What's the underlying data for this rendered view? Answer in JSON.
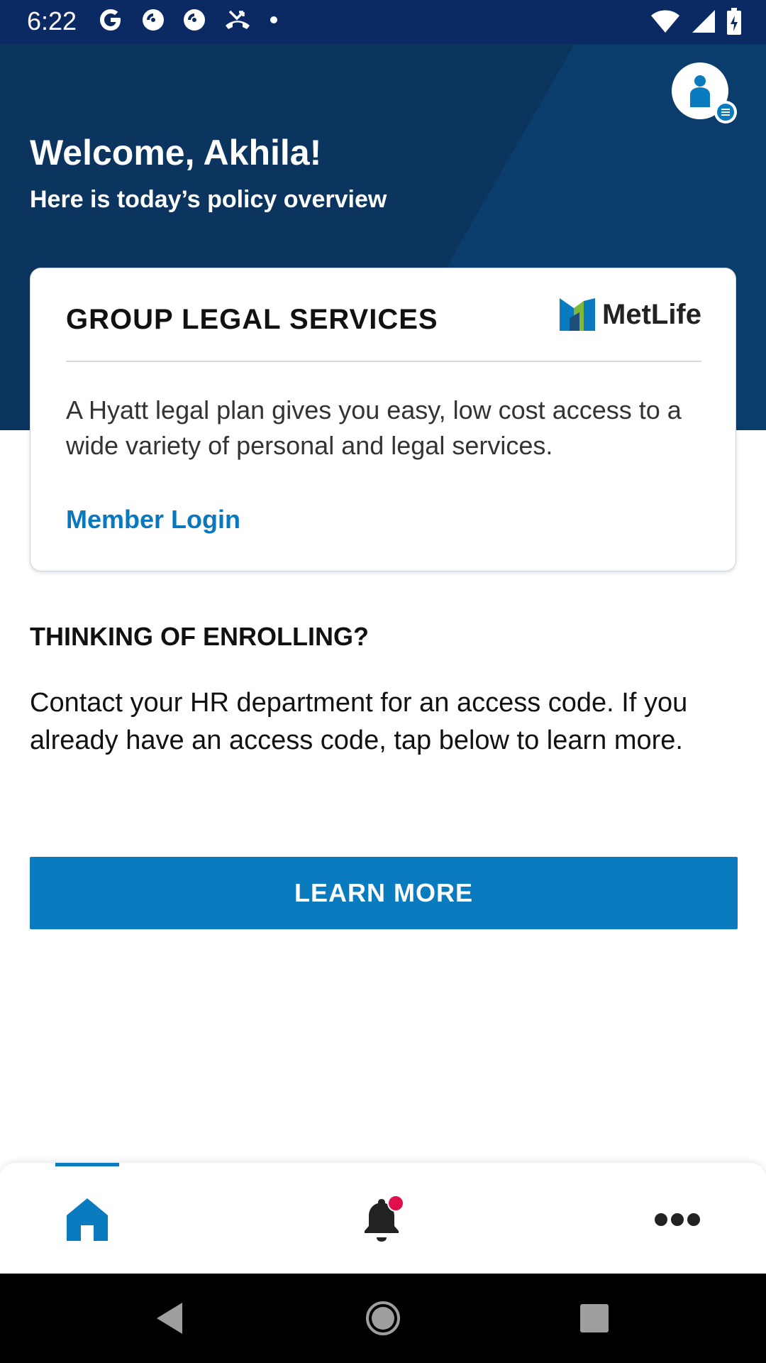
{
  "status_bar": {
    "time": "6:22",
    "icons_left": [
      "google-icon",
      "pocket-casts-icon",
      "pocket-casts-icon",
      "missed-call-icon",
      "dot-icon"
    ],
    "icons_right": [
      "wifi-icon",
      "signal-icon",
      "battery-icon"
    ]
  },
  "header": {
    "welcome": "Welcome, Akhila!",
    "subtitle": "Here is today’s policy overview",
    "colors": {
      "background": "#0b355f",
      "status_bar": "#0b2a63"
    }
  },
  "policy_card": {
    "title": "GROUP LEGAL SERVICES",
    "logo_text": "MetLife",
    "description": "A Hyatt legal plan gives you easy, low cost access to a wide variety of personal and legal services.",
    "link_label": "Member Login"
  },
  "enroll": {
    "heading": "THINKING OF ENROLLING?",
    "body": "Contact your HR department for an access code. If you already have an access code, tap below to learn more.",
    "button_label": "LEARN MORE",
    "accent": "#0b7bc0"
  },
  "bottom_nav": {
    "items": [
      {
        "icon": "home-icon",
        "active": true
      },
      {
        "icon": "bell-icon",
        "has_notification": true
      },
      {
        "icon": "more-icon"
      }
    ],
    "notification_color": "#e0104f"
  }
}
